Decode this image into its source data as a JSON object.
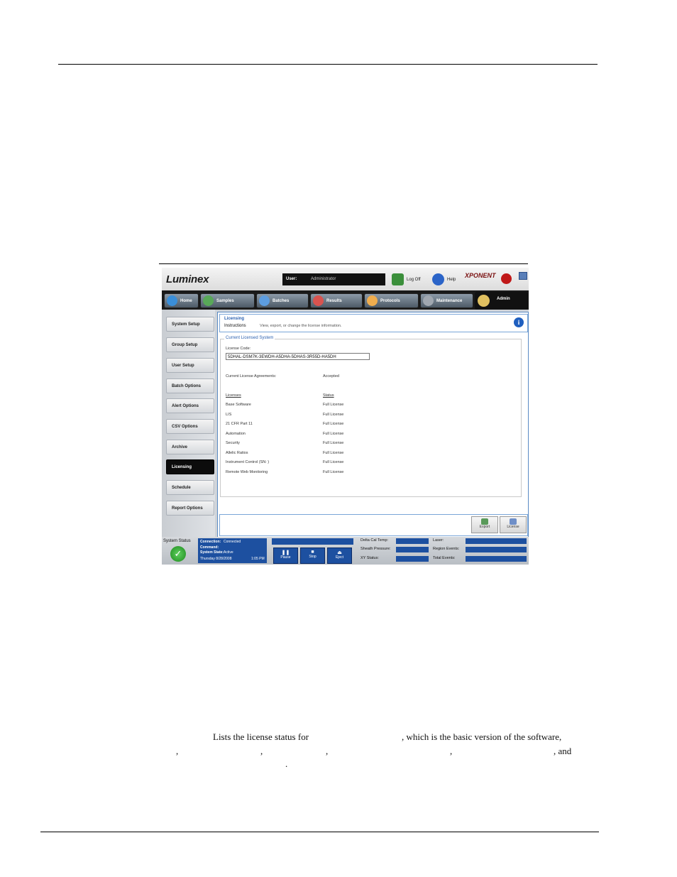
{
  "app": {
    "logo": "Luminex",
    "user_label": "User:",
    "user_value": "Administrator",
    "logoff_label": "Log Off",
    "help_label": "Help",
    "brand": "XPONENT"
  },
  "nav": {
    "tabs": [
      {
        "label": "Home"
      },
      {
        "label": "Samples"
      },
      {
        "label": "Batches"
      },
      {
        "label": "Results"
      },
      {
        "label": "Protocols"
      },
      {
        "label": "Maintenance"
      },
      {
        "label": "Admin"
      }
    ]
  },
  "sidebar": {
    "items": [
      {
        "label": "System Setup"
      },
      {
        "label": "Group Setup"
      },
      {
        "label": "User Setup"
      },
      {
        "label": "Batch Options"
      },
      {
        "label": "Alert Options"
      },
      {
        "label": "CSV Options"
      },
      {
        "label": "Archive"
      },
      {
        "label": "Licensing"
      },
      {
        "label": "Schedule"
      },
      {
        "label": "Report Options"
      }
    ]
  },
  "header": {
    "title": "Licensing",
    "instructions_label": "Instructions",
    "description": "View, export, or change the license information."
  },
  "license": {
    "section_title": "Current Licensed System",
    "code_label": "License Code:",
    "code_value": "5DHAL-DSM7K-3EWDH-A5DHA-5DHAS-3R55D-HA5DH",
    "agreements_label": "Current License Agreements:",
    "agreements_value": "Accepted",
    "col_licenses": "Licenses",
    "col_status": "Status",
    "rows": [
      {
        "name": "Base Software",
        "status": "Full License"
      },
      {
        "name": "LIS",
        "status": "Full License"
      },
      {
        "name": "21 CFR Part 11",
        "status": "Full License"
      },
      {
        "name": "Automation",
        "status": "Full License"
      },
      {
        "name": "Security",
        "status": "Full License"
      },
      {
        "name": "Allelic Ratios",
        "status": "Full License"
      },
      {
        "name": "Instrument Control (SN: )",
        "status": "Full License"
      },
      {
        "name": "Remote Web Monitoring",
        "status": "Full License"
      }
    ]
  },
  "footer": {
    "export_label": "Export",
    "license_label": "License"
  },
  "status": {
    "system_status_label": "System Status",
    "connection_label": "Connection:",
    "connection_value": "Connected",
    "command_label": "Command:",
    "system_state_label": "System State:",
    "system_state_value": "Active",
    "date": "Thursday 8/28/2008",
    "time": "1:05 PM",
    "pause_label": "Pause",
    "stop_label": "Stop",
    "eject_label": "Eject",
    "delta_cal_temp_label": "Delta Cal Temp:",
    "sheath_pressure_label": "Sheath Pressure:",
    "xy_status_label": "XY Status:",
    "laser_label": "Laser:",
    "region_events_label": "Region Events:",
    "total_events_label": "Total Events:"
  },
  "doc": {
    "paragraph_line1_a": "Lists the license status for",
    "paragraph_line1_b": ", which is the basic version of the software,",
    "comma": ",",
    "and": ", and",
    "period": "."
  }
}
